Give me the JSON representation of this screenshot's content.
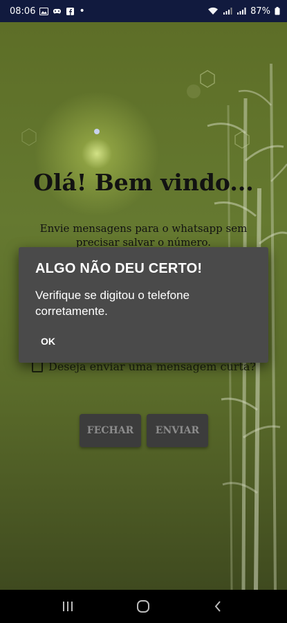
{
  "status_bar": {
    "time": "08:06",
    "bullet": "•",
    "battery_percent": "87%",
    "icons_left": [
      "gallery-icon",
      "game-controller-icon",
      "facebook-icon",
      "notification-dot-icon"
    ],
    "icons_right": [
      "wifi-icon",
      "signal-icon",
      "signal-icon",
      "battery-icon"
    ]
  },
  "main": {
    "welcome_title": "Olá! Bem vindo...",
    "subtitle": "Envie mensagens para o whatsapp sem precisar salvar o número.",
    "checkbox_label": "Deseja enviar uma mensagem curta?",
    "checkbox_checked": false,
    "close_button": "FECHAR",
    "send_button": "ENVIAR"
  },
  "dialog": {
    "title": "ALGO NÃO DEU CERTO!",
    "message": "Verifique se digitou o telefone corretamente.",
    "ok_button": "OK"
  },
  "nav_bar": {
    "buttons": [
      "recent-apps-icon",
      "home-icon",
      "back-icon"
    ]
  },
  "colors": {
    "status_bar_bg": "#111a3e",
    "background_top": "#5d6e27",
    "dialog_bg": "#4a4a4a",
    "button_bg": "#3c3c3c",
    "button_text": "#8c8c8c"
  }
}
